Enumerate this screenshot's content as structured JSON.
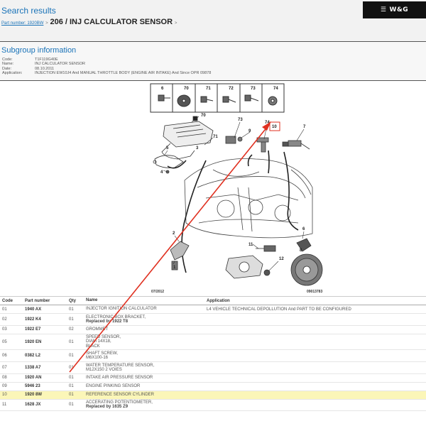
{
  "header": {
    "search_results": "Search results",
    "breadcrumb_link": "Part number: 1920BW",
    "breadcrumb_sep": ">",
    "breadcrumb_code": "206",
    "breadcrumb_name": " / INJ CALCULATOR SENSOR",
    "breadcrumb_trail": ">",
    "logo": "W&G"
  },
  "subgroup": {
    "title": "Subgroup information",
    "fields": [
      {
        "key": "Code:",
        "value": "T1F119G40E"
      },
      {
        "key": "Name:",
        "value": "INJ CALCULATOR SENSOR"
      },
      {
        "key": "Date:",
        "value": "08.10.2011"
      },
      {
        "key": "Application:",
        "value": "INJECTION EW10J4 And MANUAL THROTTLE BODY (ENGINE AIR INTAKE) And Since OPR 09878"
      }
    ]
  },
  "diagram": {
    "hardware_numbers": [
      "6",
      "70",
      "71",
      "72",
      "73",
      "74"
    ],
    "callouts": [
      "70",
      "71",
      "73",
      "74",
      "10",
      "7",
      "9",
      "5",
      "4",
      "3",
      "2",
      "1",
      "11",
      "12",
      "6",
      "8"
    ],
    "footer_left": "07/2012",
    "footer_right": "09013783",
    "highlight_color": "#e03020",
    "highlight_target": "10"
  },
  "table": {
    "headers": {
      "code": "Code",
      "part_number": "Part number",
      "qty": "Qty",
      "name": "Name",
      "application": "Application"
    },
    "rows": [
      {
        "code": "01",
        "part_number": "1940 AX",
        "qty": "01",
        "name": "INJECTOR IGNITION CALCULATOR",
        "note": "",
        "application": "L4 VEHICLE TECHNICAL DEPOLLUTION And PART TO BE CONFIGURED"
      },
      {
        "code": "02",
        "part_number": "1922 K4",
        "qty": "01",
        "name": "ELECTRONIC BOX BRACKET,",
        "note": "Replaced by 1922 T8",
        "application": ""
      },
      {
        "code": "03",
        "part_number": "1922 E7",
        "qty": "02",
        "name": "GROMMET",
        "note": "",
        "application": ""
      },
      {
        "code": "05",
        "part_number": "1920 EN",
        "qty": "01",
        "name": "SPEED SENSOR,\nDIAM 14X18,\nBLACK",
        "note": "",
        "application": ""
      },
      {
        "code": "06",
        "part_number": "0382 L2",
        "qty": "01",
        "name": "SHAFT SCREW,\nM6X100-16",
        "note": "",
        "application": ""
      },
      {
        "code": "07",
        "part_number": "1338 A7",
        "qty": "01",
        "name": "WATER TEMPERATURE SENSOR,\nM12X150 2 VOIES",
        "note": "",
        "application": ""
      },
      {
        "code": "08",
        "part_number": "1920 AN",
        "qty": "01",
        "name": "INTAKE AIR PRESSURE SENSOR",
        "note": "",
        "application": ""
      },
      {
        "code": "09",
        "part_number": "5946 23",
        "qty": "01",
        "name": "ENGINE PINKING SENSOR",
        "note": "",
        "application": ""
      },
      {
        "code": "10",
        "part_number": "1920 8W",
        "qty": "01",
        "name": "REFERENCE SENSOR CYLINDER",
        "note": "",
        "application": "",
        "highlight": true
      },
      {
        "code": "11",
        "part_number": "1628 JX",
        "qty": "01",
        "name": "ACCERATING POTENTIOMETER,",
        "note": "Replaced by 1635 Z9",
        "application": ""
      }
    ]
  }
}
